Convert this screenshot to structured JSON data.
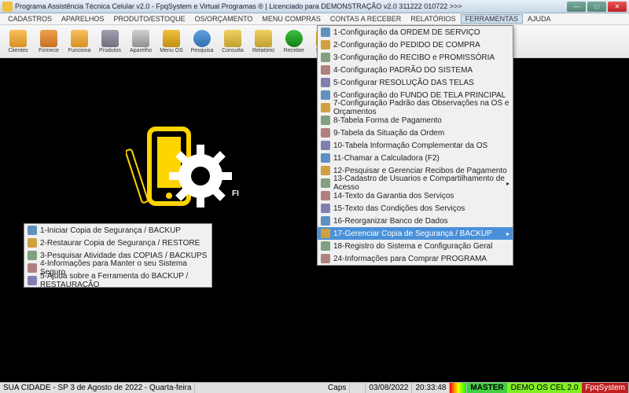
{
  "title": "Programa Assistência Técnica Celular v2.0 - FpqSystem e Virtual Programas ® | Licenciado para  DEMONSTRAÇÃO v2.0 311222 010722 >>>",
  "menubar": [
    "CADASTROS",
    "APARELHOS",
    "PRODUTO/ESTOQUE",
    "OS/ORÇAMENTO",
    "MENU COMPRAS",
    "CONTAS A RECEBER",
    "RELATÓRIOS",
    "FERRAMENTAS",
    "AJUDA"
  ],
  "toolbar": [
    {
      "label": "Clientes",
      "cls": "ic1"
    },
    {
      "label": "Fornece",
      "cls": "ic2"
    },
    {
      "label": "Funciona",
      "cls": "ic1"
    },
    {
      "label": "Produtos",
      "cls": "ic3"
    },
    {
      "label": "Aparelho",
      "cls": "ic4"
    },
    {
      "label": "Menu OS",
      "cls": "ic5"
    },
    {
      "label": "Pesquisa",
      "cls": "ic6"
    },
    {
      "label": "Consulta",
      "cls": "ic7"
    },
    {
      "label": "Relatório",
      "cls": "ic7"
    },
    {
      "label": "Receber",
      "cls": "ic8"
    },
    {
      "label": "Recibo",
      "cls": "ic9"
    }
  ],
  "ferramentas_menu": [
    "1-Configuração da ORDEM DE SERVIÇO",
    "2-Configuração do PEDIDO DE COMPRA",
    "3-Configuração do RECIBO e PROMISSÓRIA",
    "4-Configuração PADRÃO DO SISTEMA",
    "5-Configurar RESOLUÇÃO DAS TELAS",
    "6-Configuração do FUNDO DE TELA PRINCIPAL",
    "7-Configuração Padrão das Observações na OS e Orçamentos",
    "8-Tabela Forma de Pagamento",
    "9-Tabela da Situação da Ordem",
    "10-Tabela Informação Complementar da OS",
    "11-Chamar a Calculadora (F2)",
    "12-Pesquisar e Gerenciar Recibos de Pagamento",
    "13-Cadastro de Usuarios e Compartilhamento de Acesso",
    "14-Texto da Garantia dos Serviços",
    "15-Texto das Condições dos Serviços",
    "16-Reorganizar Banco de Dados",
    "17-Gerenciar Copia de Segurança / BACKUP",
    "18-Registro do Sistema e Configuração Geral",
    "24-Informações para Comprar PROGRAMA"
  ],
  "backup_submenu": [
    "1-Iniciar Copia de Segurança / BACKUP",
    "2-Restaurar Copia de Segurança / RESTORE",
    "3-Pesquisar Atividade das COPIAS / BACKUPS",
    "4-Informações para Manter o seu Sistema Seguro",
    "5-Ajuda sobre a Ferramenta do BACKUP / RESTAURAÇÃO"
  ],
  "status": {
    "left": "SUA CIDADE - SP  3 de Agosto de 2022  -  Quarta-feira",
    "caps": "Caps",
    "date": "03/08/2022",
    "time": "20:33:48",
    "master": "MASTER",
    "demo": "DEMO OS CEL 2.0",
    "brand": "FpqSystem"
  }
}
